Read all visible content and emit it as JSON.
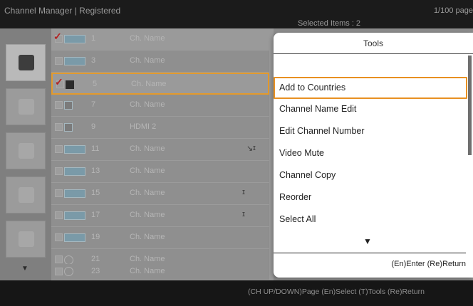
{
  "topbar": {
    "title": "Channel Manager | Registered",
    "page_info": "1/100 page",
    "selected_items": "Selected Items : 2"
  },
  "channels": [
    {
      "checked": true,
      "icon": "tv-icon",
      "number": "1",
      "name": "Ch. Name"
    },
    {
      "checked": false,
      "icon": "tv-icon",
      "number": "3",
      "name": "Ch. Name"
    },
    {
      "checked": true,
      "icon": "lock-icon",
      "number": "5",
      "name": "Ch. Name"
    },
    {
      "checked": false,
      "icon": "lock-icon",
      "number": "7",
      "name": "Ch. Name"
    },
    {
      "checked": false,
      "icon": "hdmi-icon",
      "number": "9",
      "name": "HDMI 2"
    },
    {
      "checked": false,
      "icon": "tv-icon",
      "number": "11",
      "name": "Ch. Name"
    },
    {
      "checked": false,
      "icon": "tv-icon",
      "number": "13",
      "name": "Ch. Name"
    },
    {
      "checked": false,
      "icon": "tv-icon",
      "number": "15",
      "name": "Ch. Name"
    },
    {
      "checked": false,
      "icon": "tv-icon",
      "number": "17",
      "name": "Ch. Name"
    },
    {
      "checked": false,
      "icon": "tv-icon",
      "number": "19",
      "name": "Ch. Name"
    },
    {
      "checked": false,
      "icon": "antenna-icon",
      "number": "21",
      "name": "Ch. Name"
    },
    {
      "checked": false,
      "icon": "antenna-icon",
      "number": "23",
      "name": "Ch. Name"
    }
  ],
  "tools": {
    "title": "Tools",
    "items": [
      "Add to Countries",
      "Channel Name Edit",
      "Edit Channel Number",
      "Video Mute",
      "Channel Copy",
      "Reorder",
      "Select All"
    ],
    "footer": "(En)Enter  (Re)Return"
  },
  "bottombar": {
    "hint": "(CH UP/DOWN)Page  (En)Select  (T)Tools  (Re)Return"
  },
  "colors": {
    "focus": "#e89022",
    "check": "#b22222"
  }
}
